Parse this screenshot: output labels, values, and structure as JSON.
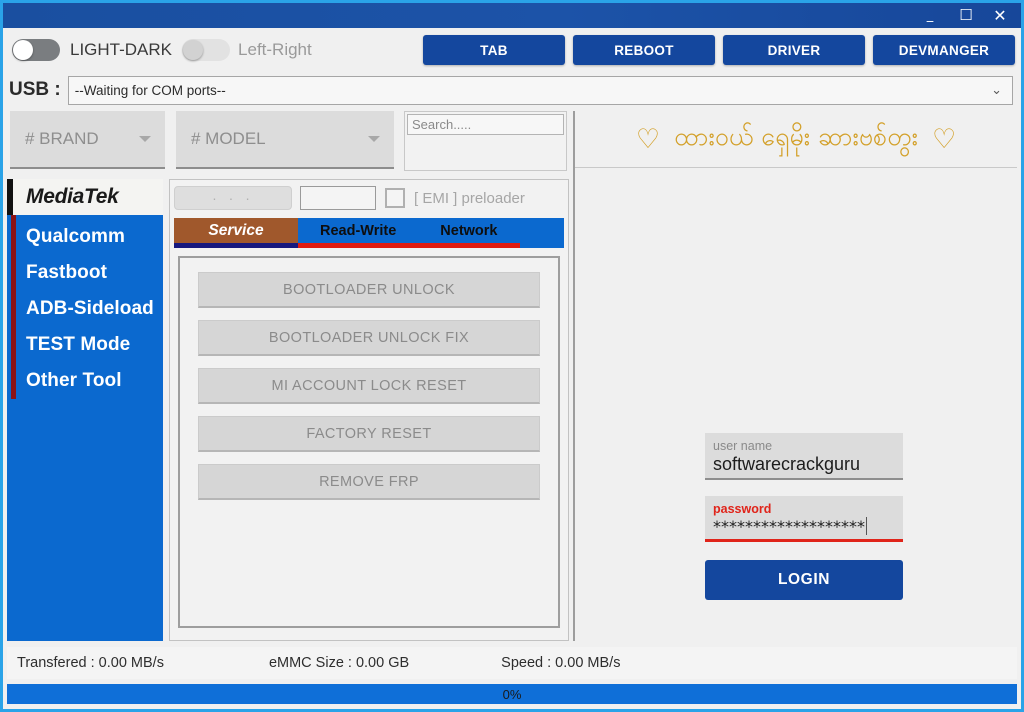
{
  "window": {
    "minimize_icon": "minimize-icon",
    "maximize_icon": "maximize-icon",
    "close_icon": "close-icon",
    "minimize_glyph": "_",
    "maximize_glyph": "☐",
    "close_glyph": "✕"
  },
  "toolbar": {
    "toggle_light_dark_label": "LIGHT-DARK",
    "toggle_left_right_label": "Left-Right",
    "buttons": [
      {
        "label": "TAB",
        "name": "tab-button"
      },
      {
        "label": "REBOOT",
        "name": "reboot-button"
      },
      {
        "label": "DRIVER",
        "name": "driver-button"
      },
      {
        "label": "DEVMANGER",
        "name": "devmanger-button"
      }
    ]
  },
  "usb": {
    "label": "USB :",
    "value": "--Waiting for COM ports--",
    "chevron": "⌄"
  },
  "selectors": {
    "brand": "# BRAND",
    "model": "# MODEL",
    "search_placeholder": "Search....."
  },
  "sidebar": {
    "active": {
      "label": "MediaTek"
    },
    "items": [
      {
        "label": "Qualcomm"
      },
      {
        "label": "Fastboot"
      },
      {
        "label": "ADB-Sideload"
      },
      {
        "label": "TEST Mode"
      },
      {
        "label": "Other Tool"
      }
    ]
  },
  "panel": {
    "dots_button": "· · ·",
    "emi_input_value": "",
    "emi_label": "[ EMI ] preloader",
    "tabs": [
      {
        "label": "Service",
        "active": true
      },
      {
        "label": "Read-Write",
        "active": false
      },
      {
        "label": "Network",
        "active": false
      }
    ],
    "actions": [
      {
        "label": "BOOTLOADER UNLOCK"
      },
      {
        "label": "BOOTLOADER UNLOCK FIX"
      },
      {
        "label": "MI ACCOUNT LOCK RESET"
      },
      {
        "label": "FACTORY RESET"
      },
      {
        "label": "REMOVE FRP"
      }
    ]
  },
  "right": {
    "banner_text": "ထားဝယ် ရှေမိုး ဆားဗစ်တွး",
    "heart_glyph": "♡",
    "login": {
      "user_label": "user name",
      "user_value": "softwarecrackguru",
      "password_label": "password",
      "password_value": "*******************",
      "login_button": "LOGIN"
    }
  },
  "status": {
    "transferred": "Transfered  : 0.00 MB/s",
    "emmc_size": "eMMC Size : 0.00 GB",
    "speed": "Speed : 0.00 MB/s",
    "progress_percent": "0%"
  },
  "colors": {
    "title_blue": "#1a4fa0",
    "button_blue": "#14479e",
    "sidebar_blue": "#0b69cf",
    "tab_active_brown": "#a0582c",
    "tab_underline_navy": "#16187e",
    "tab_underline_red": "#e01b10",
    "accent_red": "#e0241a",
    "banner_gold": "#d3a029",
    "window_border": "#2aa3e8",
    "sidebar_strip_red": "#8b1216"
  }
}
